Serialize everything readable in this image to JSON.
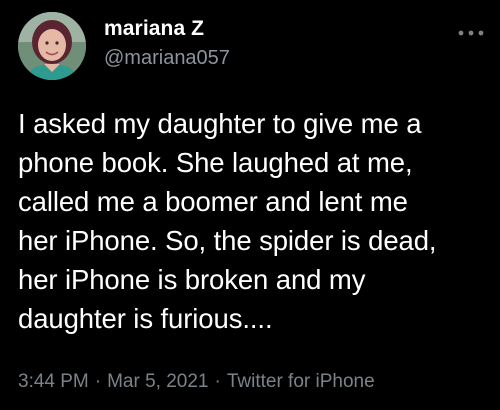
{
  "tweet": {
    "author": {
      "display_name": "mariana Z",
      "handle": "@mariana057",
      "avatar_icon": "profile-photo"
    },
    "more_icon": "more-horizontal-icon",
    "text_lines": [
      "I asked my daughter to give me a",
      "phone book. She laughed at me,",
      "called me a boomer and lent me",
      "her iPhone. So, the spider is dead,",
      "her iPhone is broken and my",
      "daughter is furious...."
    ],
    "meta": {
      "time": "3:44 PM",
      "separator": "·",
      "date": "Mar 5, 2021",
      "source": "Twitter for iPhone"
    }
  },
  "colors": {
    "background": "#000000",
    "text_primary": "#ffffff",
    "text_secondary": "#8b949c"
  }
}
